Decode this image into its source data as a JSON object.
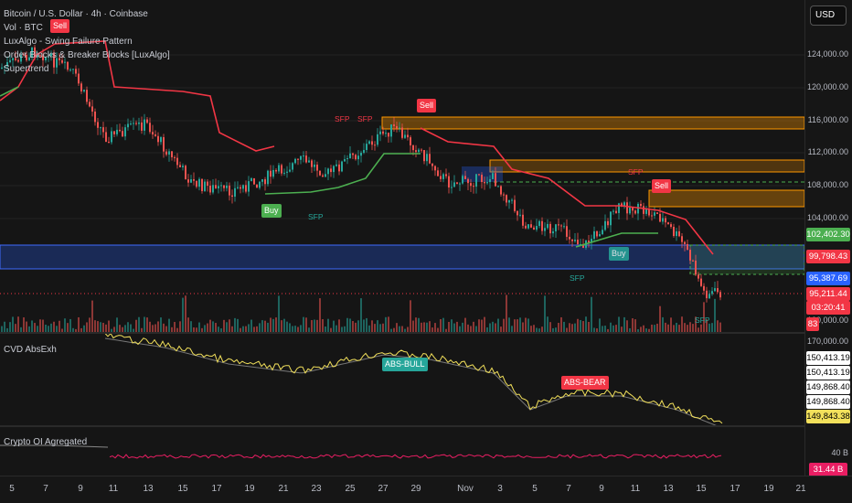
{
  "legend": {
    "symbol": "Bitcoin / U.S. Dollar · 4h · Coinbase",
    "vol": "Vol · BTC",
    "ind1": "LuxAlgo - Swing Failure Pattern",
    "ind2": "Order Blocks & Breaker Blocks [LuxAlgo]",
    "ind3": "Supertrend",
    "cvd": "CVD AbsExh",
    "oi": "Crypto OI Agregated"
  },
  "currency_button": "USD",
  "price_axis": [
    "124,000.00",
    "120,000.00",
    "116,000.00",
    "112,000.00",
    "108,000.00",
    "104,000.00",
    "100,000.00"
  ],
  "price_tags": {
    "green": "102,402.30",
    "red1": "99,798.43",
    "blue": "95,387.69",
    "red2": "95,211.44",
    "countdown": "03:20:41",
    "vol": "83"
  },
  "cvd_axis": {
    "top": "170,000.00",
    "labels": [
      "150,413.19",
      "150,413.19",
      "149,868.40",
      "149,868.40"
    ],
    "current": "149,843.38"
  },
  "oi_axis": {
    "label": "40 B",
    "current": "31.44 B"
  },
  "signals": {
    "sell": "Sell",
    "buy": "Buy",
    "sfp": "SFP",
    "abs_bull": "ABS-BULL",
    "abs_bear": "ABS-BEAR"
  },
  "time_axis": [
    "5",
    "7",
    "9",
    "11",
    "13",
    "15",
    "17",
    "19",
    "21",
    "23",
    "25",
    "27",
    "29",
    "Nov",
    "3",
    "5",
    "7",
    "9",
    "11",
    "13",
    "15",
    "17",
    "19",
    "21"
  ],
  "colors": {
    "bull": "#26a69a",
    "bear": "#ef5350",
    "st_green": "#4caf50",
    "st_red": "#f23645",
    "orange": "#ff9800",
    "blue_zone": "#2962ff",
    "yellow": "#f2e05b"
  }
}
